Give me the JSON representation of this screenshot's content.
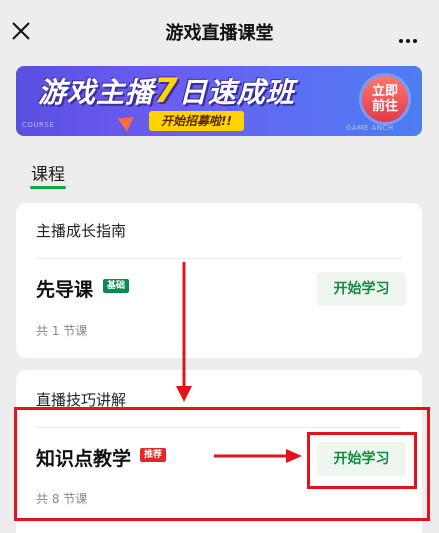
{
  "header": {
    "title": "游戏直播课堂",
    "close_icon": "close-icon",
    "more_icon": "more-dots-icon"
  },
  "banner": {
    "title_part1": "游戏主播",
    "title_number": "7",
    "title_part2": "日速成班",
    "subtitle": "开始招募啦!!",
    "cta": "立即前往",
    "small_left": "COURSE",
    "small_right": "GAME ANCH"
  },
  "tabs": [
    {
      "label": "课程",
      "active": true
    }
  ],
  "sections": [
    {
      "header": "主播成长指南",
      "lesson": {
        "title": "先导课",
        "badge": "基础",
        "button": "开始学习",
        "count": "共 1 节课"
      }
    },
    {
      "header": "直播技巧讲解",
      "lesson": {
        "title": "知识点教学",
        "badge": "推荐",
        "button": "开始学习",
        "count": "共 8 节课"
      }
    }
  ],
  "colors": {
    "accent_green": "#16a34a",
    "annotation_red": "#e1141b",
    "badge_basic": "#0b8a55",
    "badge_recommend": "#e5262a"
  }
}
